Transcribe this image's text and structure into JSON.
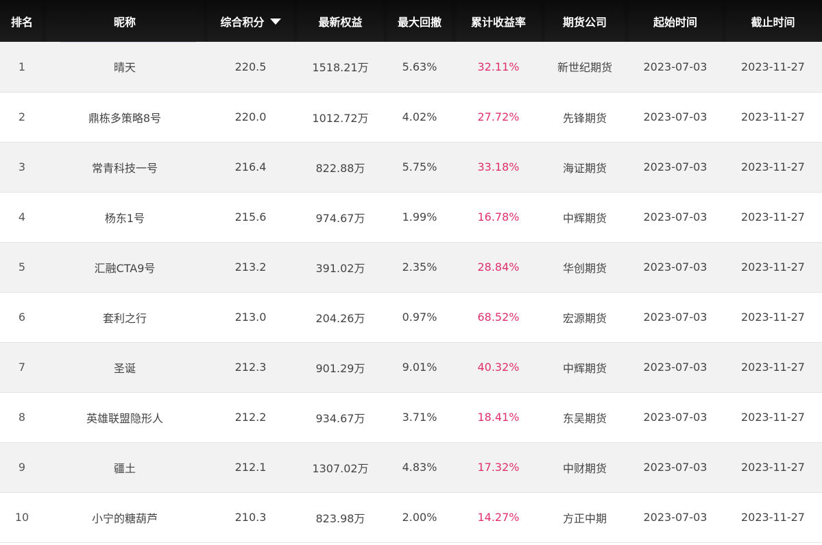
{
  "columns": {
    "rank": "排名",
    "nickname": "昵称",
    "score": "综合积分",
    "equity": "最新权益",
    "max_drawdown": "最大回撤",
    "cum_return": "累计收益率",
    "futures_firm": "期货公司",
    "start_date": "起始时间",
    "end_date": "截止时间"
  },
  "sort": {
    "column": "score",
    "direction": "desc"
  },
  "colors": {
    "header_bg": "#111111",
    "return_text": "#e0306a",
    "stripe": "#f2f2f2"
  },
  "rows": [
    {
      "rank": "1",
      "nickname": "晴天",
      "score": "220.5",
      "equity": "1518.21万",
      "max_drawdown": "5.63%",
      "cum_return": "32.11%",
      "futures_firm": "新世纪期货",
      "start_date": "2023-07-03",
      "end_date": "2023-11-27"
    },
    {
      "rank": "2",
      "nickname": "鼎栋多策略8号",
      "score": "220.0",
      "equity": "1012.72万",
      "max_drawdown": "4.02%",
      "cum_return": "27.72%",
      "futures_firm": "先锋期货",
      "start_date": "2023-07-03",
      "end_date": "2023-11-27"
    },
    {
      "rank": "3",
      "nickname": "常青科技一号",
      "score": "216.4",
      "equity": "822.88万",
      "max_drawdown": "5.75%",
      "cum_return": "33.18%",
      "futures_firm": "海证期货",
      "start_date": "2023-07-03",
      "end_date": "2023-11-27"
    },
    {
      "rank": "4",
      "nickname": "杨东1号",
      "score": "215.6",
      "equity": "974.67万",
      "max_drawdown": "1.99%",
      "cum_return": "16.78%",
      "futures_firm": "中辉期货",
      "start_date": "2023-07-03",
      "end_date": "2023-11-27"
    },
    {
      "rank": "5",
      "nickname": "汇融CTA9号",
      "score": "213.2",
      "equity": "391.02万",
      "max_drawdown": "2.35%",
      "cum_return": "28.84%",
      "futures_firm": "华创期货",
      "start_date": "2023-07-03",
      "end_date": "2023-11-27"
    },
    {
      "rank": "6",
      "nickname": "套利之行",
      "score": "213.0",
      "equity": "204.26万",
      "max_drawdown": "0.97%",
      "cum_return": "68.52%",
      "futures_firm": "宏源期货",
      "start_date": "2023-07-03",
      "end_date": "2023-11-27"
    },
    {
      "rank": "7",
      "nickname": "圣诞",
      "score": "212.3",
      "equity": "901.29万",
      "max_drawdown": "9.01%",
      "cum_return": "40.32%",
      "futures_firm": "中辉期货",
      "start_date": "2023-07-03",
      "end_date": "2023-11-27"
    },
    {
      "rank": "8",
      "nickname": "英雄联盟隐形人",
      "score": "212.2",
      "equity": "934.67万",
      "max_drawdown": "3.71%",
      "cum_return": "18.41%",
      "futures_firm": "东吴期货",
      "start_date": "2023-07-03",
      "end_date": "2023-11-27"
    },
    {
      "rank": "9",
      "nickname": "疆土",
      "score": "212.1",
      "equity": "1307.02万",
      "max_drawdown": "4.83%",
      "cum_return": "17.32%",
      "futures_firm": "中财期货",
      "start_date": "2023-07-03",
      "end_date": "2023-11-27"
    },
    {
      "rank": "10",
      "nickname": "小宁的糖葫芦",
      "score": "210.3",
      "equity": "823.98万",
      "max_drawdown": "2.00%",
      "cum_return": "14.27%",
      "futures_firm": "方正中期",
      "start_date": "2023-07-03",
      "end_date": "2023-11-27"
    }
  ]
}
